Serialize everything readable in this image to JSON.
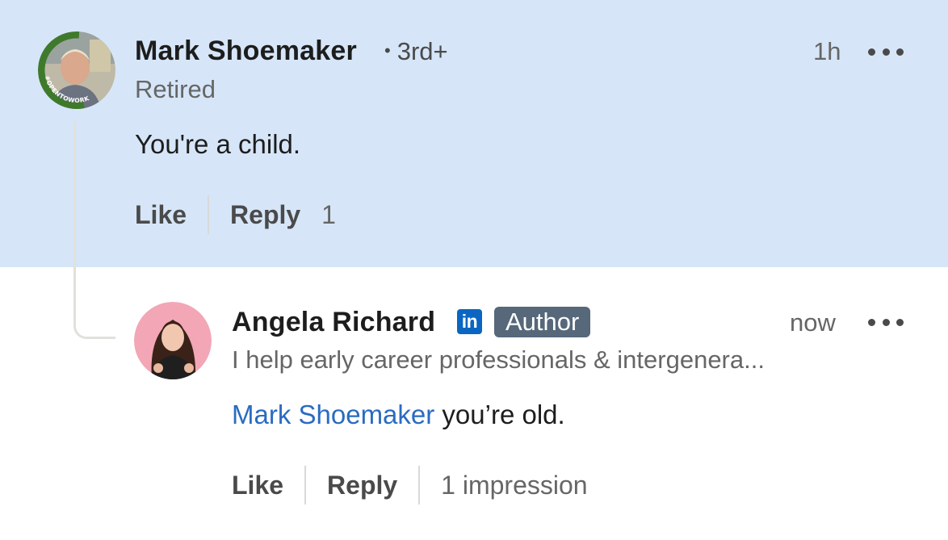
{
  "parent_comment": {
    "author_name": "Mark Shoemaker",
    "connection_degree": "3rd+",
    "headline": "Retired",
    "timestamp": "1h",
    "text": "You're a child.",
    "avatar_badge_text": "#OPENTOWORK",
    "actions": {
      "like_label": "Like",
      "reply_label": "Reply",
      "reply_count": "1"
    }
  },
  "reply_comment": {
    "author_name": "Angela Richard",
    "author_badge": "Author",
    "linkedin_badge": "in",
    "headline": "I help early career professionals & intergenera...",
    "timestamp": "now",
    "mention": "Mark Shoemaker",
    "text": " you’re old.",
    "actions": {
      "like_label": "Like",
      "reply_label": "Reply",
      "impressions": "1 impression"
    }
  },
  "colors": {
    "highlight_background": "#d6e6f8",
    "mention_link": "#2a6cc0",
    "author_badge": "#56687a",
    "linkedin_blue": "#0a66c2",
    "open_to_work_ring": "#3f7a2c"
  }
}
